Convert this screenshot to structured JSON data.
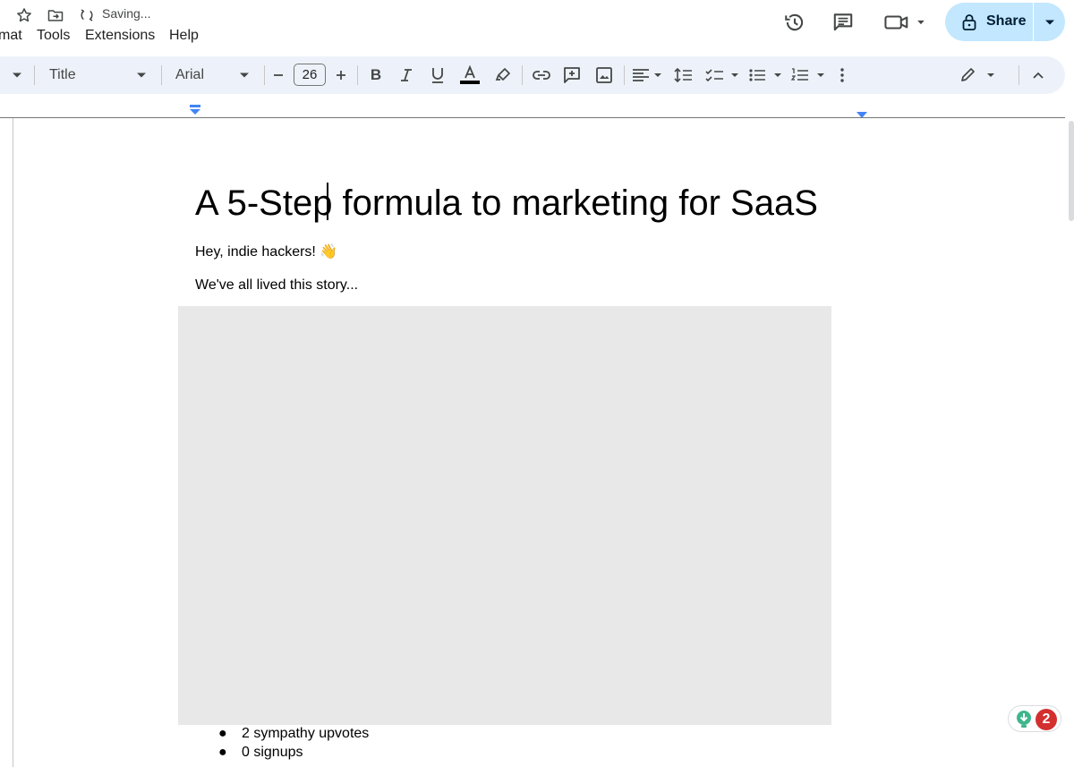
{
  "header": {
    "status": "Saving...",
    "share_label": "Share"
  },
  "menu": {
    "items": [
      "mat",
      "Tools",
      "Extensions",
      "Help"
    ]
  },
  "toolbar": {
    "style_select": "Title",
    "font_select": "Arial",
    "font_size": "26"
  },
  "document": {
    "title": "A 5-Step formula to marketing for SaaS",
    "greeting": "Hey, indie hackers! 👋",
    "intro": "We've all lived this story...",
    "bullets": [
      "2 sympathy upvotes",
      "0 signups"
    ]
  },
  "extension": {
    "badge_count": "2"
  },
  "icons": {
    "star": "star-icon",
    "move": "move-to-folder-icon",
    "sync": "sync-icon",
    "history": "version-history-icon",
    "comments": "comments-icon",
    "meet": "video-call-icon",
    "lock": "lock-icon"
  },
  "colors": {
    "share_bg": "#c2e7ff",
    "toolbar_bg": "#edf2fa",
    "ruler_marker": "#4285f4",
    "badge_red": "#d32f2f"
  }
}
